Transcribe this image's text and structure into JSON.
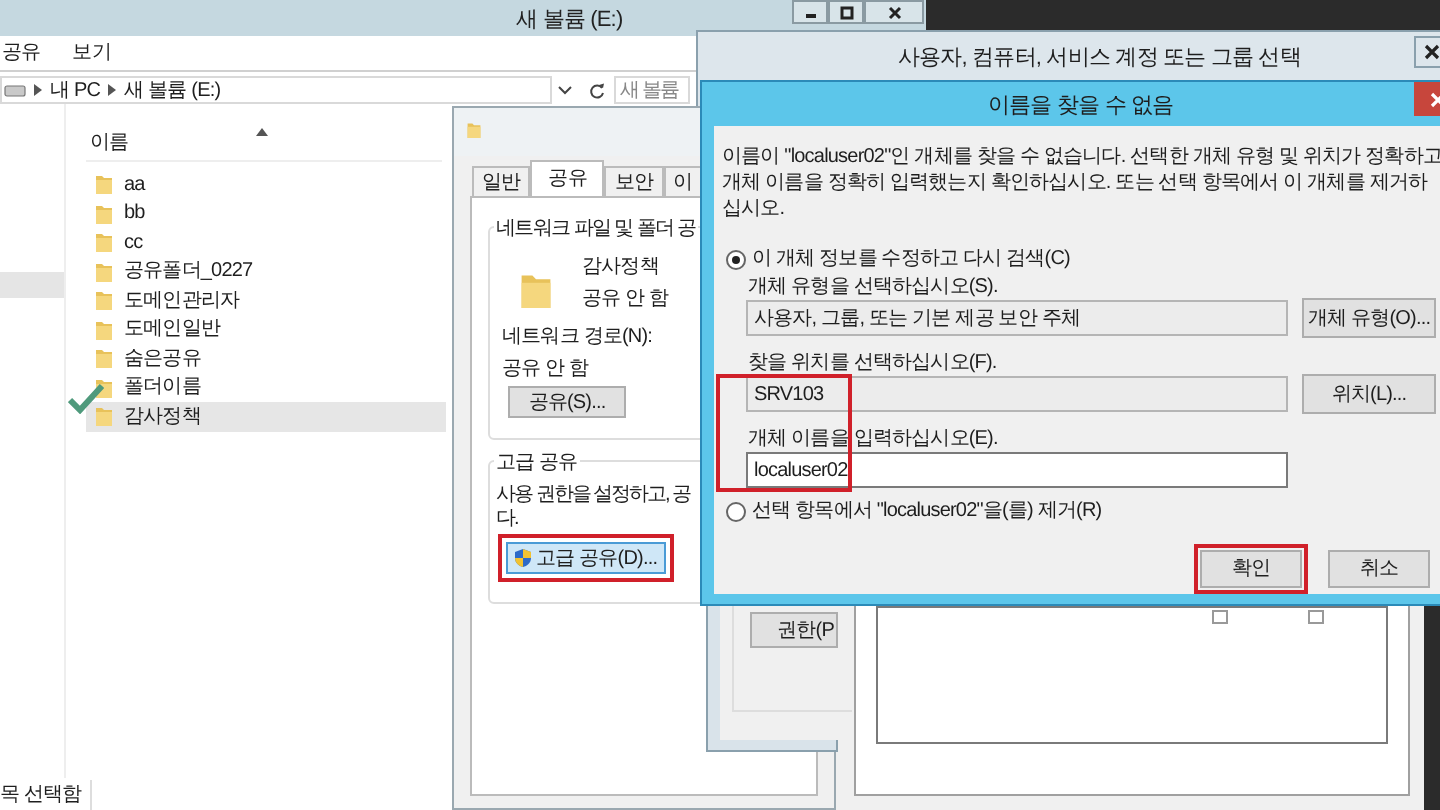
{
  "explorer": {
    "title": "새 볼륨 (E:)",
    "menu": [
      "공유",
      "보기"
    ],
    "breadcrumb": [
      "내 PC",
      "새 볼륨 (E:)"
    ],
    "search_placeholder": "새 볼륨",
    "column": "이름",
    "rows": [
      {
        "name": "aa",
        "selected": false
      },
      {
        "name": "bb",
        "selected": false
      },
      {
        "name": "cc",
        "selected": false
      },
      {
        "name": "공유폴더_0227",
        "selected": false
      },
      {
        "name": "도메인관리자",
        "selected": false
      },
      {
        "name": "도메인일반",
        "selected": false
      },
      {
        "name": "숨은공유",
        "selected": false
      },
      {
        "name": "폴더이름",
        "selected": false
      },
      {
        "name": "감사정책",
        "selected": true
      }
    ],
    "status": "목 선택함"
  },
  "properties": {
    "tabs": [
      {
        "label": "일반",
        "selected": false
      },
      {
        "label": "공유",
        "selected": true
      },
      {
        "label": "보안",
        "selected": false
      },
      {
        "label": "이",
        "selected": false
      }
    ],
    "share_group": "네트워크 파일 및 폴더 공",
    "folder_name": "감사정책",
    "share_state": "공유 안 함",
    "path_label": "네트워크 경로(N):",
    "path_value": "공유 안 함",
    "share_button": "공유(S)...",
    "advanced_group": "고급 공유",
    "advanced_lines": [
      "사용 권한을 설정하고, 공",
      "다."
    ],
    "advanced_button": {
      "label": "고급 공유(D)...",
      "highlighted": true
    }
  },
  "advanced_sharing": {
    "button": "권한(P"
  },
  "select_dialog": {
    "title": "사용자, 컴퓨터, 서비스 계정 또는 그룹 선택",
    "checks": [
      {
        "checked": false
      },
      {
        "checked": false
      }
    ]
  },
  "error_dialog": {
    "title": "이름을 찾을 수 없음",
    "message": "이름이 \"localuser02\"인 개체를 찾을 수 없습니다. 선택한 개체 유형 및 위치가 정확하고 개체 이름을 정확히 입력했는지 확인하십시오. 또는 선택 항목에서 이 개체를 제거하십시오.",
    "search_option": {
      "label": "이 개체 정보를 수정하고 다시 검색(C)",
      "selected": true
    },
    "fields": [
      {
        "label": "개체 유형을 선택하십시오(S).",
        "value": "사용자, 그룹, 또는 기본 제공 보안 주체",
        "button": "개체 유형(O)...",
        "editable": false
      },
      {
        "label": "찾을 위치를 선택하십시오(F).",
        "value": "SRV103",
        "button": "위치(L)...",
        "editable": false
      },
      {
        "label": "개체 이름을 입력하십시오(E).",
        "value": "localuser02",
        "editable": true
      }
    ],
    "remove_option": {
      "label": "선택 항목에서 \"localuser02\"을(를) 제거(R)",
      "selected": false
    },
    "buttons": [
      {
        "label": "확인",
        "highlighted": true
      },
      {
        "label": "취소",
        "highlighted": false
      }
    ]
  }
}
